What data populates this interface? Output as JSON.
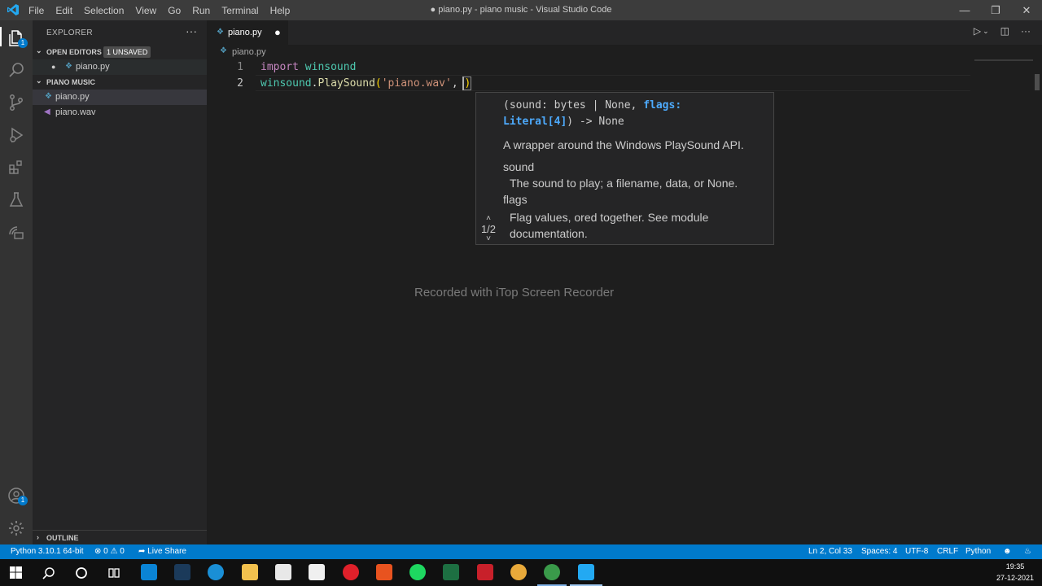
{
  "titlebar": {
    "menu": [
      "File",
      "Edit",
      "Selection",
      "View",
      "Go",
      "Run",
      "Terminal",
      "Help"
    ],
    "title": "● piano.py - piano music - Visual Studio Code"
  },
  "sidebar": {
    "header": "EXPLORER",
    "open_editors": {
      "label": "OPEN EDITORS",
      "badge": "1 UNSAVED",
      "files": [
        "piano.py"
      ]
    },
    "folder": {
      "label": "PIANO MUSIC",
      "files": [
        "piano.py",
        "piano.wav"
      ]
    },
    "outline": "OUTLINE"
  },
  "tab": {
    "name": "piano.py"
  },
  "breadcrumb": "piano.py",
  "code": {
    "line_numbers": [
      "1",
      "2"
    ],
    "line1": {
      "kw": "import",
      "mod": "winsound"
    },
    "line2": {
      "obj": "winsound",
      "dot": ".",
      "fn": "PlaySound",
      "open": "(",
      "str": "'piano.wav'",
      "comma": ",",
      "close": ")"
    }
  },
  "hover": {
    "sig_start": "(sound: bytes | None, ",
    "sig_param": "flags:",
    "sig_type": "Literal[4]",
    "sig_end": ") -> None",
    "description": "A wrapper around the Windows PlaySound API.",
    "param1": "sound",
    "param1_desc": "The sound to play; a filename, data, or None.",
    "param2": "flags",
    "param2_desc": "Flag values, ored together. See module documentation.",
    "overload": "1/2"
  },
  "watermark": "Recorded with iTop Screen Recorder",
  "statusbar": {
    "interpreter": "Python 3.10.1 64-bit",
    "errors": "0",
    "warnings": "0",
    "liveshare": "Live Share",
    "position": "Ln 2, Col 33",
    "spaces": "Spaces: 4",
    "encoding": "UTF-8",
    "eol": "CRLF",
    "language": "Python"
  },
  "clock": {
    "time": "19:35",
    "date": "27-12-2021"
  },
  "colors": {
    "accent": "#007acc",
    "python_icon": "#519aba",
    "string": "#ce9178",
    "keyword": "#c586c0"
  }
}
